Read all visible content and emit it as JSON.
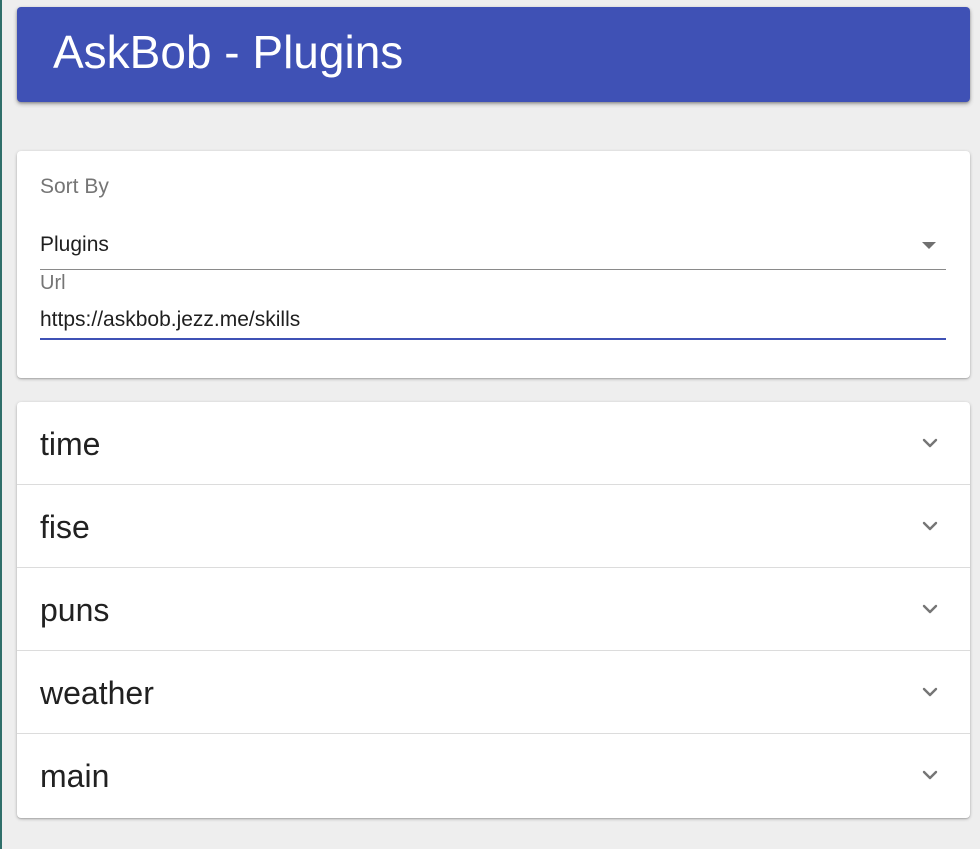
{
  "header": {
    "title": "AskBob - Plugins"
  },
  "settings": {
    "sort_label": "Sort By",
    "sort_value": "Plugins",
    "url_label": "Url",
    "url_value": "https://askbob.jezz.me/skills"
  },
  "plugins": [
    {
      "name": "time",
      "icon": "chevron-down-icon"
    },
    {
      "name": "fise",
      "icon": "chevron-down-icon"
    },
    {
      "name": "puns",
      "icon": "chevron-down-icon"
    },
    {
      "name": "weather",
      "icon": "chevron-down-icon"
    },
    {
      "name": "main",
      "icon": "chevron-down-icon"
    }
  ],
  "colors": {
    "primary": "#3f51b5",
    "background": "#eeeeee",
    "card": "#ffffff"
  }
}
